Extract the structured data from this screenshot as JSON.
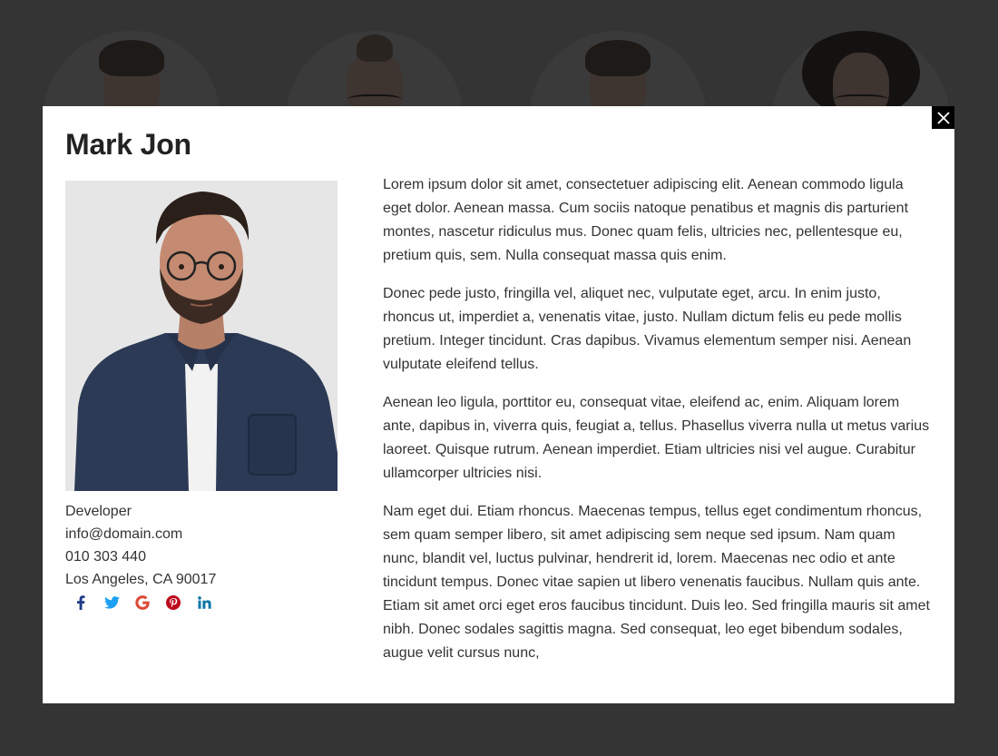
{
  "modal": {
    "name": "Mark Jon",
    "close_label": "×",
    "photo_alt": "Mark Jon",
    "role": "Developer",
    "email": "info@domain.com",
    "phone": "010 303 440",
    "location": "Los Angeles, CA 90017",
    "social": [
      {
        "network": "facebook",
        "icon": "facebook-icon",
        "color": "#1f3c88"
      },
      {
        "network": "twitter",
        "icon": "twitter-icon",
        "color": "#1da1f2"
      },
      {
        "network": "google",
        "icon": "google-icon",
        "color": "#dd4b39"
      },
      {
        "network": "pinterest",
        "icon": "pinterest-icon",
        "color": "#bd081c"
      },
      {
        "network": "linkedin",
        "icon": "linkedin-icon",
        "color": "#0e76a8"
      }
    ],
    "bio": [
      "Lorem ipsum dolor sit amet, consectetuer adipiscing elit. Aenean commodo ligula eget dolor. Aenean massa. Cum sociis natoque penatibus et magnis dis parturient montes, nascetur ridiculus mus. Donec quam felis, ultricies nec, pellentesque eu, pretium quis, sem. Nulla consequat massa quis enim.",
      "Donec pede justo, fringilla vel, aliquet nec, vulputate eget, arcu. In enim justo, rhoncus ut, imperdiet a, venenatis vitae, justo. Nullam dictum felis eu pede mollis pretium. Integer tincidunt. Cras dapibus. Vivamus elementum semper nisi. Aenean vulputate eleifend tellus.",
      "Aenean leo ligula, porttitor eu, consequat vitae, eleifend ac, enim. Aliquam lorem ante, dapibus in, viverra quis, feugiat a, tellus. Phasellus viverra nulla ut metus varius laoreet. Quisque rutrum. Aenean imperdiet. Etiam ultricies nisi vel augue. Curabitur ullamcorper ultricies nisi.",
      "Nam eget dui. Etiam rhoncus. Maecenas tempus, tellus eget condimentum rhoncus, sem quam semper libero, sit amet adipiscing sem neque sed ipsum. Nam quam nunc, blandit vel, luctus pulvinar, hendrerit id, lorem. Maecenas nec odio et ante tincidunt tempus. Donec vitae sapien ut libero venenatis faucibus. Nullam quis ante. Etiam sit amet orci eget eros faucibus tincidunt. Duis leo. Sed fringilla mauris sit amet nibh. Donec sodales sagittis magna. Sed consequat, leo eget bibendum sodales, augue velit cursus nunc,"
    ]
  },
  "background": {
    "overlay_color": "#343434",
    "team_avatars": [
      "team-member-avatar",
      "team-member-avatar",
      "team-member-avatar",
      "team-member-avatar"
    ]
  }
}
